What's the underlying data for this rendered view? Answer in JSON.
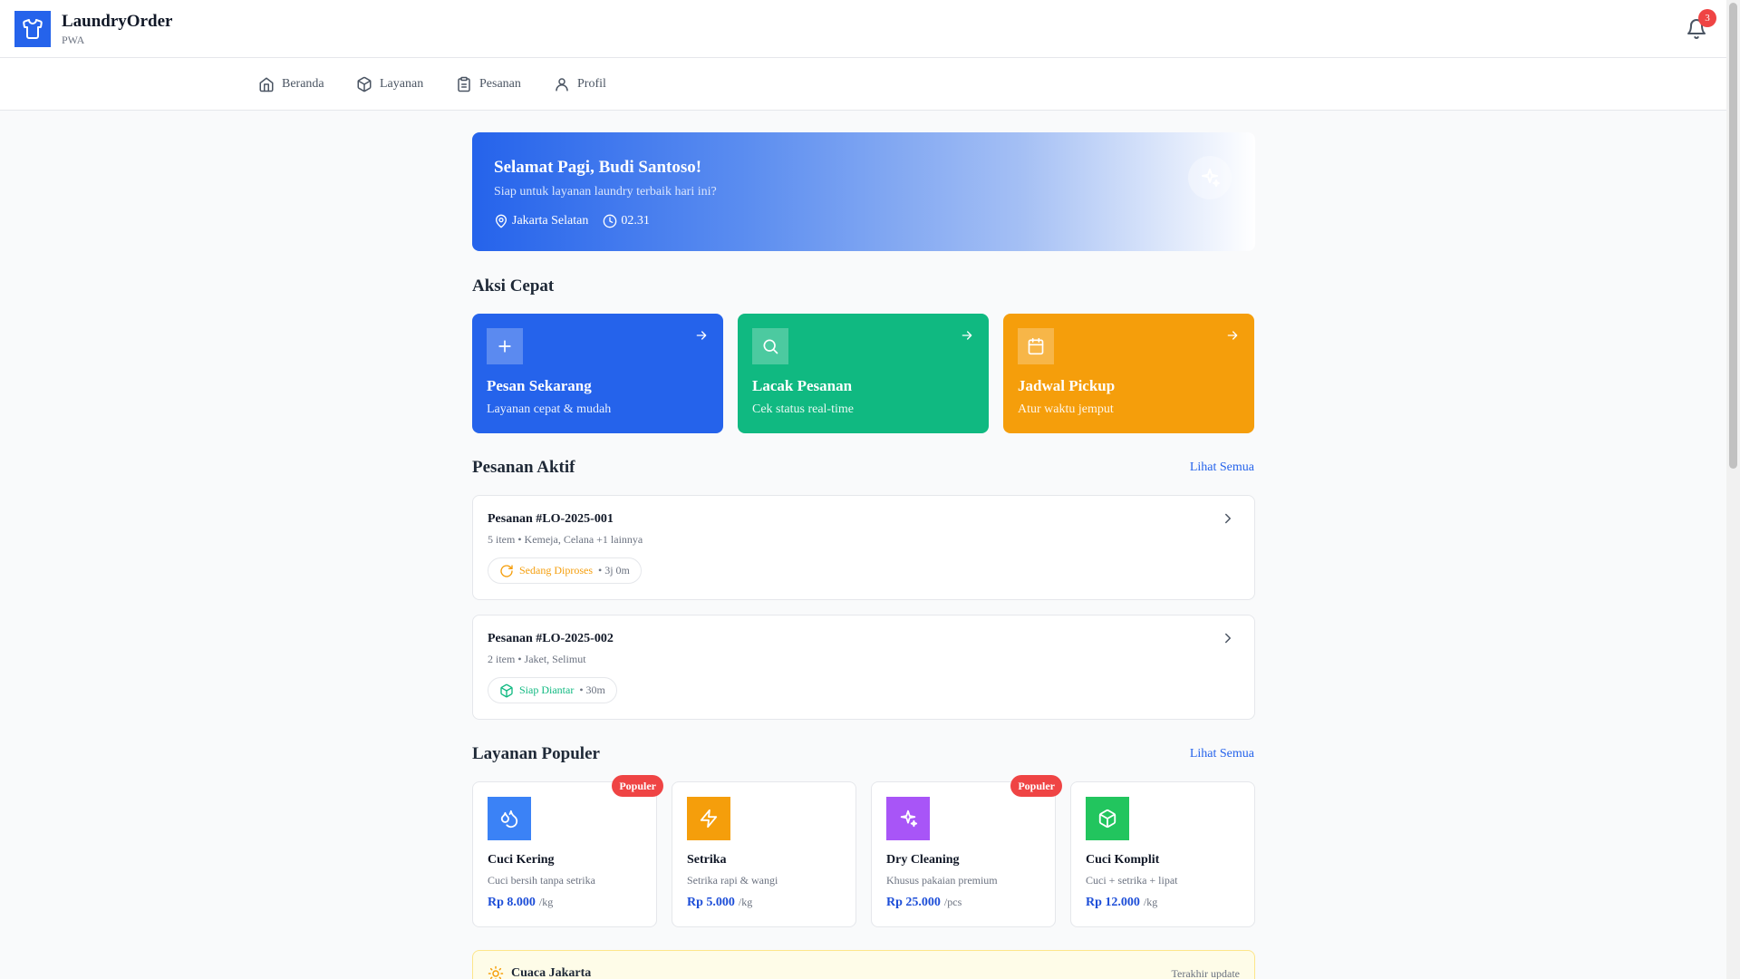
{
  "app": {
    "title": "LaundryOrder",
    "subtitle": "PWA",
    "notification_count": "3"
  },
  "nav": [
    {
      "label": "Beranda",
      "icon": "home-icon"
    },
    {
      "label": "Layanan",
      "icon": "package-icon"
    },
    {
      "label": "Pesanan",
      "icon": "clipboard-icon"
    },
    {
      "label": "Profil",
      "icon": "user-icon"
    }
  ],
  "hero": {
    "greeting": "Selamat Pagi, Budi Santoso!",
    "subtitle": "Siap untuk layanan laundry terbaik hari ini?",
    "location": "Jakarta Selatan",
    "time": "02.31"
  },
  "quick_actions": {
    "title": "Aksi Cepat",
    "items": [
      {
        "title": "Pesan Sekarang",
        "subtitle": "Layanan cepat & mudah",
        "color": "#2563eb"
      },
      {
        "title": "Lacak Pesanan",
        "subtitle": "Cek status real-time",
        "color": "#10b981"
      },
      {
        "title": "Jadwal Pickup",
        "subtitle": "Atur waktu jemput",
        "color": "#f59e0b"
      }
    ]
  },
  "active_orders": {
    "title": "Pesanan Aktif",
    "see_all": "Lihat Semua",
    "items": [
      {
        "title": "Pesanan #LO-2025-001",
        "items": "5 item • Kemeja, Celana +1 lainnya",
        "status": "Sedang Diproses",
        "duration": "• 3j 0m",
        "status_color": "#f59e0b"
      },
      {
        "title": "Pesanan #LO-2025-002",
        "items": "2 item • Jaket, Selimut",
        "status": "Siap Diantar",
        "duration": "• 30m",
        "status_color": "#10b981"
      }
    ]
  },
  "popular_services": {
    "title": "Layanan Populer",
    "see_all": "Lihat Semua",
    "badge": "Populer",
    "items": [
      {
        "name": "Cuci Kering",
        "desc": "Cuci bersih tanpa setrika",
        "price": "Rp 8.000",
        "unit": "/kg",
        "color": "#3b82f6",
        "popular": true
      },
      {
        "name": "Setrika",
        "desc": "Setrika rapi & wangi",
        "price": "Rp 5.000",
        "unit": "/kg",
        "color": "#f59e0b",
        "popular": false
      },
      {
        "name": "Dry Cleaning",
        "desc": "Khusus pakaian premium",
        "price": "Rp 25.000",
        "unit": "/pcs",
        "color": "#a855f7",
        "popular": true
      },
      {
        "name": "Cuci Komplit",
        "desc": "Cuci + setrika + lipat",
        "price": "Rp 12.000",
        "unit": "/kg",
        "color": "#22c55e",
        "popular": false
      }
    ]
  },
  "weather": {
    "title": "Cuaca Jakarta",
    "updated": "Terakhir update"
  }
}
